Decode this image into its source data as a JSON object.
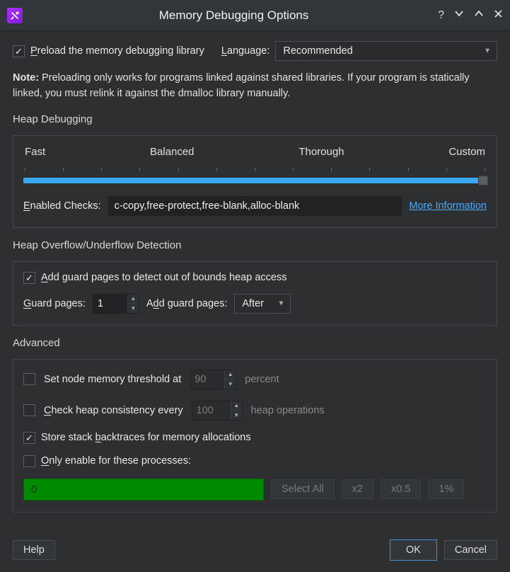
{
  "titlebar": {
    "title": "Memory Debugging Options"
  },
  "top": {
    "preload_label_pre": "P",
    "preload_label_post": "reload the memory debugging library",
    "language_label_pre": "L",
    "language_label_post": "anguage:",
    "language_value": "Recommended"
  },
  "note": {
    "bold": "Note:",
    "text": " Preloading only works for programs linked against shared libraries. If your program is statically linked, you must relink it against the dmalloc library manually."
  },
  "heap": {
    "title": "Heap Debugging",
    "slider": {
      "l0": "Fast",
      "l1": "Balanced",
      "l2": "Thorough",
      "l3": "Custom"
    },
    "enabled_pre": "E",
    "enabled_post": "nabled Checks:",
    "enabled_value": "c-copy,free-protect,free-blank,alloc-blank",
    "more_info": "More Information"
  },
  "overflow": {
    "title": "Heap Overflow/Underflow Detection",
    "add_guard_pre": "A",
    "add_guard_post": "dd guard pages to detect out of bounds heap access",
    "guard_pages_pre": "G",
    "guard_pages_post": "uard pages:",
    "guard_value": "1",
    "add_pages_pre": "A",
    "add_pages_mid": "d",
    "add_pages_post": "d guard pages:",
    "after_value": "After"
  },
  "advanced": {
    "title": "Advanced",
    "threshold_label": "Set node memory threshold at",
    "threshold_value": "90",
    "threshold_suffix": "percent",
    "check_pre": "C",
    "check_post": "heck heap consistency every",
    "check_value": "100",
    "check_suffix": "heap operations",
    "backtrace_pre": "Store stack ",
    "backtrace_u": "b",
    "backtrace_post": "acktraces for memory allocations",
    "only_pre": "O",
    "only_post": "nly enable for these processes:",
    "proc_value": "0",
    "btn_select_all": "Select All",
    "btn_x2": "x2",
    "btn_x05": "x0.5",
    "btn_1pct": "1%"
  },
  "footer": {
    "help": "Help",
    "ok": "OK",
    "cancel": "Cancel"
  }
}
